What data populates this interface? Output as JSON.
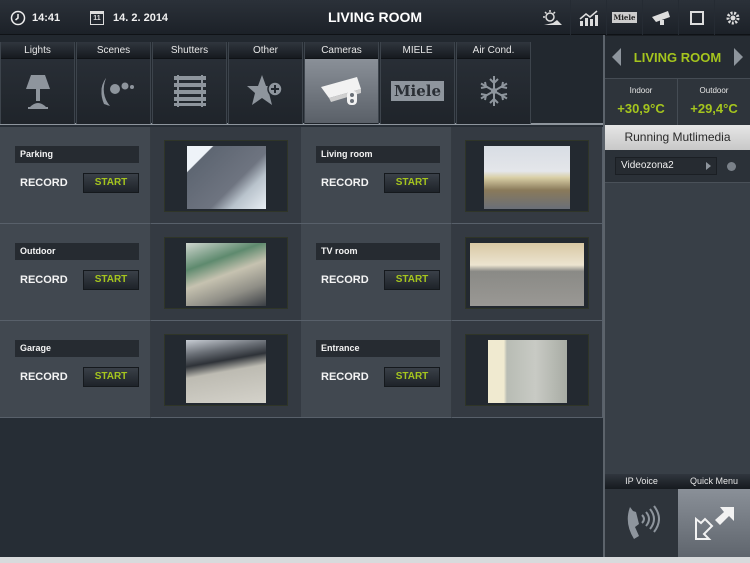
{
  "topbar": {
    "time": "14:41",
    "date": "14. 2. 2014",
    "date_icon_day": "11",
    "title": "LIVING ROOM",
    "icons": [
      "weather-icon",
      "statistics-icon",
      "miele-icon",
      "camera-icon",
      "window-icon",
      "settings-icon"
    ],
    "miele_text": "Miele"
  },
  "tabs": [
    {
      "label": "Lights",
      "icon": "lamp-icon",
      "active": false
    },
    {
      "label": "Scenes",
      "icon": "scenes-icon",
      "active": false
    },
    {
      "label": "Shutters",
      "icon": "shutters-icon",
      "active": false
    },
    {
      "label": "Other",
      "icon": "star-plus-icon",
      "active": false
    },
    {
      "label": "Cameras",
      "icon": "camera-icon",
      "active": true
    },
    {
      "label": "MIELE",
      "icon": "miele-logo-icon",
      "active": false,
      "logo_text": "Miele"
    },
    {
      "label": "Air Cond.",
      "icon": "snowflake-icon",
      "active": false
    }
  ],
  "cameras": [
    {
      "name": "Parking",
      "record_label": "RECORD",
      "button": "START"
    },
    {
      "name": "Living room",
      "record_label": "RECORD",
      "button": "START"
    },
    {
      "name": "Outdoor",
      "record_label": "RECORD",
      "button": "START"
    },
    {
      "name": "TV room",
      "record_label": "RECORD",
      "button": "START"
    },
    {
      "name": "Garage",
      "record_label": "RECORD",
      "button": "START"
    },
    {
      "name": "Entrance",
      "record_label": "RECORD",
      "button": "START"
    }
  ],
  "sidebar": {
    "room": "LIVING ROOM",
    "indoor_label": "Indoor",
    "indoor_value": "+30,9°C",
    "outdoor_label": "Outdoor",
    "outdoor_value": "+29,4°C",
    "multimedia_header": "Running Mutlimedia",
    "multimedia_zone": "Videozona2",
    "bottom_tabs": [
      {
        "label": "IP Voice",
        "icon": "phone-icon",
        "active": false
      },
      {
        "label": "Quick Menu",
        "icon": "quick-menu-icon",
        "active": true
      }
    ]
  },
  "colors": {
    "accent": "#a5c51e",
    "background": "#262d35"
  }
}
